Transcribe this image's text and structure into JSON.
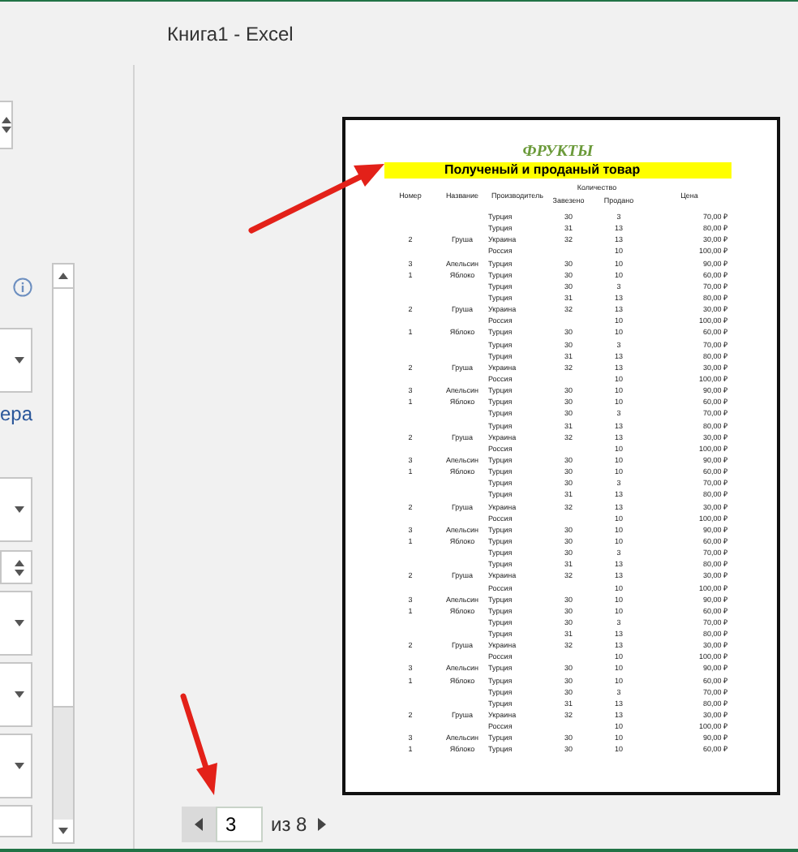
{
  "window": {
    "title": "Книга1 - Excel"
  },
  "settings_panel": {
    "link_text": "ера"
  },
  "preview": {
    "page": {
      "title": "ФРУКТЫ",
      "subtitle": "Полученый и проданый товар",
      "group_header": "Количество",
      "columns": [
        "Номер",
        "Название",
        "Производитель",
        "Завезено",
        "Продано",
        "Цена"
      ],
      "rows": [
        {
          "producer": "Турция",
          "imported": "30",
          "sold": "3",
          "price": "70,00 ₽"
        },
        {
          "producer": "Турция",
          "imported": "31",
          "sold": "13",
          "price": "80,00 ₽"
        },
        {
          "number": "2",
          "name": "Груша",
          "producer": "Украина",
          "imported": "32",
          "sold": "13",
          "price": "30,00 ₽"
        },
        {
          "producer": "Россия",
          "sold": "10",
          "price": "100,00 ₽"
        },
        {
          "number": "3",
          "name": "Апельсин",
          "producer": "Турция",
          "imported": "30",
          "sold": "10",
          "price": "90,00 ₽"
        },
        {
          "number": "1",
          "name": "Яблоко",
          "producer": "Турция",
          "imported": "30",
          "sold": "10",
          "price": "60,00 ₽"
        },
        {
          "producer": "Турция",
          "imported": "30",
          "sold": "3",
          "price": "70,00 ₽"
        },
        {
          "producer": "Турция",
          "imported": "31",
          "sold": "13",
          "price": "80,00 ₽"
        },
        {
          "number": "2",
          "name": "Груша",
          "producer": "Украина",
          "imported": "32",
          "sold": "13",
          "price": "30,00 ₽"
        },
        {
          "producer": "Россия",
          "sold": "10",
          "price": "100,00 ₽"
        },
        {
          "number": "1",
          "name": "Яблоко",
          "producer": "Турция",
          "imported": "30",
          "sold": "10",
          "price": "60,00 ₽"
        },
        {
          "producer": "Турция",
          "imported": "30",
          "sold": "3",
          "price": "70,00 ₽"
        },
        {
          "producer": "Турция",
          "imported": "31",
          "sold": "13",
          "price": "80,00 ₽"
        },
        {
          "number": "2",
          "name": "Груша",
          "producer": "Украина",
          "imported": "32",
          "sold": "13",
          "price": "30,00 ₽"
        },
        {
          "producer": "Россия",
          "sold": "10",
          "price": "100,00 ₽"
        },
        {
          "number": "3",
          "name": "Апельсин",
          "producer": "Турция",
          "imported": "30",
          "sold": "10",
          "price": "90,00 ₽"
        },
        {
          "number": "1",
          "name": "Яблоко",
          "producer": "Турция",
          "imported": "30",
          "sold": "10",
          "price": "60,00 ₽"
        },
        {
          "producer": "Турция",
          "imported": "30",
          "sold": "3",
          "price": "70,00 ₽"
        },
        {
          "producer": "Турция",
          "imported": "31",
          "sold": "13",
          "price": "80,00 ₽"
        },
        {
          "number": "2",
          "name": "Груша",
          "producer": "Украина",
          "imported": "32",
          "sold": "13",
          "price": "30,00 ₽"
        },
        {
          "producer": "Россия",
          "sold": "10",
          "price": "100,00 ₽"
        },
        {
          "number": "3",
          "name": "Апельсин",
          "producer": "Турция",
          "imported": "30",
          "sold": "10",
          "price": "90,00 ₽"
        },
        {
          "number": "1",
          "name": "Яблоко",
          "producer": "Турция",
          "imported": "30",
          "sold": "10",
          "price": "60,00 ₽"
        },
        {
          "producer": "Турция",
          "imported": "30",
          "sold": "3",
          "price": "70,00 ₽"
        },
        {
          "producer": "Турция",
          "imported": "31",
          "sold": "13",
          "price": "80,00 ₽"
        },
        {
          "number": "2",
          "name": "Груша",
          "producer": "Украина",
          "imported": "32",
          "sold": "13",
          "price": "30,00 ₽"
        },
        {
          "producer": "Россия",
          "sold": "10",
          "price": "100,00 ₽"
        },
        {
          "number": "3",
          "name": "Апельсин",
          "producer": "Турция",
          "imported": "30",
          "sold": "10",
          "price": "90,00 ₽"
        },
        {
          "number": "1",
          "name": "Яблоко",
          "producer": "Турция",
          "imported": "30",
          "sold": "10",
          "price": "60,00 ₽"
        },
        {
          "producer": "Турция",
          "imported": "30",
          "sold": "3",
          "price": "70,00 ₽"
        },
        {
          "producer": "Турция",
          "imported": "31",
          "sold": "13",
          "price": "80,00 ₽"
        },
        {
          "number": "2",
          "name": "Груша",
          "producer": "Украина",
          "imported": "32",
          "sold": "13",
          "price": "30,00 ₽"
        },
        {
          "producer": "Россия",
          "sold": "10",
          "price": "100,00 ₽"
        },
        {
          "number": "3",
          "name": "Апельсин",
          "producer": "Турция",
          "imported": "30",
          "sold": "10",
          "price": "90,00 ₽"
        },
        {
          "number": "1",
          "name": "Яблоко",
          "producer": "Турция",
          "imported": "30",
          "sold": "10",
          "price": "60,00 ₽"
        },
        {
          "producer": "Турция",
          "imported": "30",
          "sold": "3",
          "price": "70,00 ₽"
        },
        {
          "producer": "Турция",
          "imported": "31",
          "sold": "13",
          "price": "80,00 ₽"
        },
        {
          "number": "2",
          "name": "Груша",
          "producer": "Украина",
          "imported": "32",
          "sold": "13",
          "price": "30,00 ₽"
        },
        {
          "producer": "Россия",
          "sold": "10",
          "price": "100,00 ₽"
        },
        {
          "number": "3",
          "name": "Апельсин",
          "producer": "Турция",
          "imported": "30",
          "sold": "10",
          "price": "90,00 ₽"
        },
        {
          "number": "1",
          "name": "Яблоко",
          "producer": "Турция",
          "imported": "30",
          "sold": "10",
          "price": "60,00 ₽"
        },
        {
          "producer": "Турция",
          "imported": "30",
          "sold": "3",
          "price": "70,00 ₽"
        },
        {
          "producer": "Турция",
          "imported": "31",
          "sold": "13",
          "price": "80,00 ₽"
        },
        {
          "number": "2",
          "name": "Груша",
          "producer": "Украина",
          "imported": "32",
          "sold": "13",
          "price": "30,00 ₽"
        },
        {
          "producer": "Россия",
          "sold": "10",
          "price": "100,00 ₽"
        },
        {
          "number": "3",
          "name": "Апельсин",
          "producer": "Турция",
          "imported": "30",
          "sold": "10",
          "price": "90,00 ₽"
        },
        {
          "number": "1",
          "name": "Яблоко",
          "producer": "Турция",
          "imported": "30",
          "sold": "10",
          "price": "60,00 ₽"
        }
      ]
    }
  },
  "page_nav": {
    "current": "3",
    "total_label": "из 8"
  }
}
